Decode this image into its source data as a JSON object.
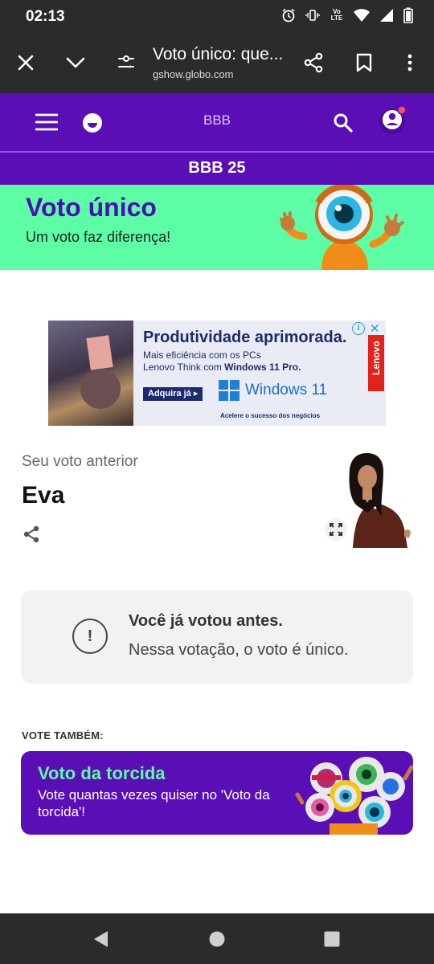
{
  "status_bar": {
    "time": "02:13",
    "network_label": "Vo LTE"
  },
  "browser": {
    "page_title": "Voto único: que...",
    "url": "gshow.globo.com"
  },
  "header": {
    "brand": "BBB",
    "section": "BBB 25"
  },
  "hero": {
    "title": "Voto único",
    "subtitle": "Um voto faz diferença!"
  },
  "ad": {
    "headline": "Produtividade aprimorada.",
    "line1": "Mais eficiência com os PCs",
    "line2_prefix": "Lenovo Think com ",
    "line2_bold": "Windows 11 Pro.",
    "cta": "Adquira já ▸",
    "windows": "Windows 11",
    "footer": "Acelere o sucesso dos negócios",
    "brand": "Lenovo"
  },
  "previous_vote": {
    "label": "Seu voto anterior",
    "name": "Eva"
  },
  "already_voted": {
    "title": "Você já votou antes.",
    "text": "Nessa votação, o voto é único.",
    "icon": "!"
  },
  "vote_also": {
    "label": "VOTE TAMBÉM:",
    "card_title": "Voto da torcida",
    "card_text": "Vote quantas vezes quiser no 'Voto da torcida'!"
  },
  "colors": {
    "purple": "#5a0eb5",
    "green": "#5dfda6",
    "dark": "#2b2b2b"
  }
}
